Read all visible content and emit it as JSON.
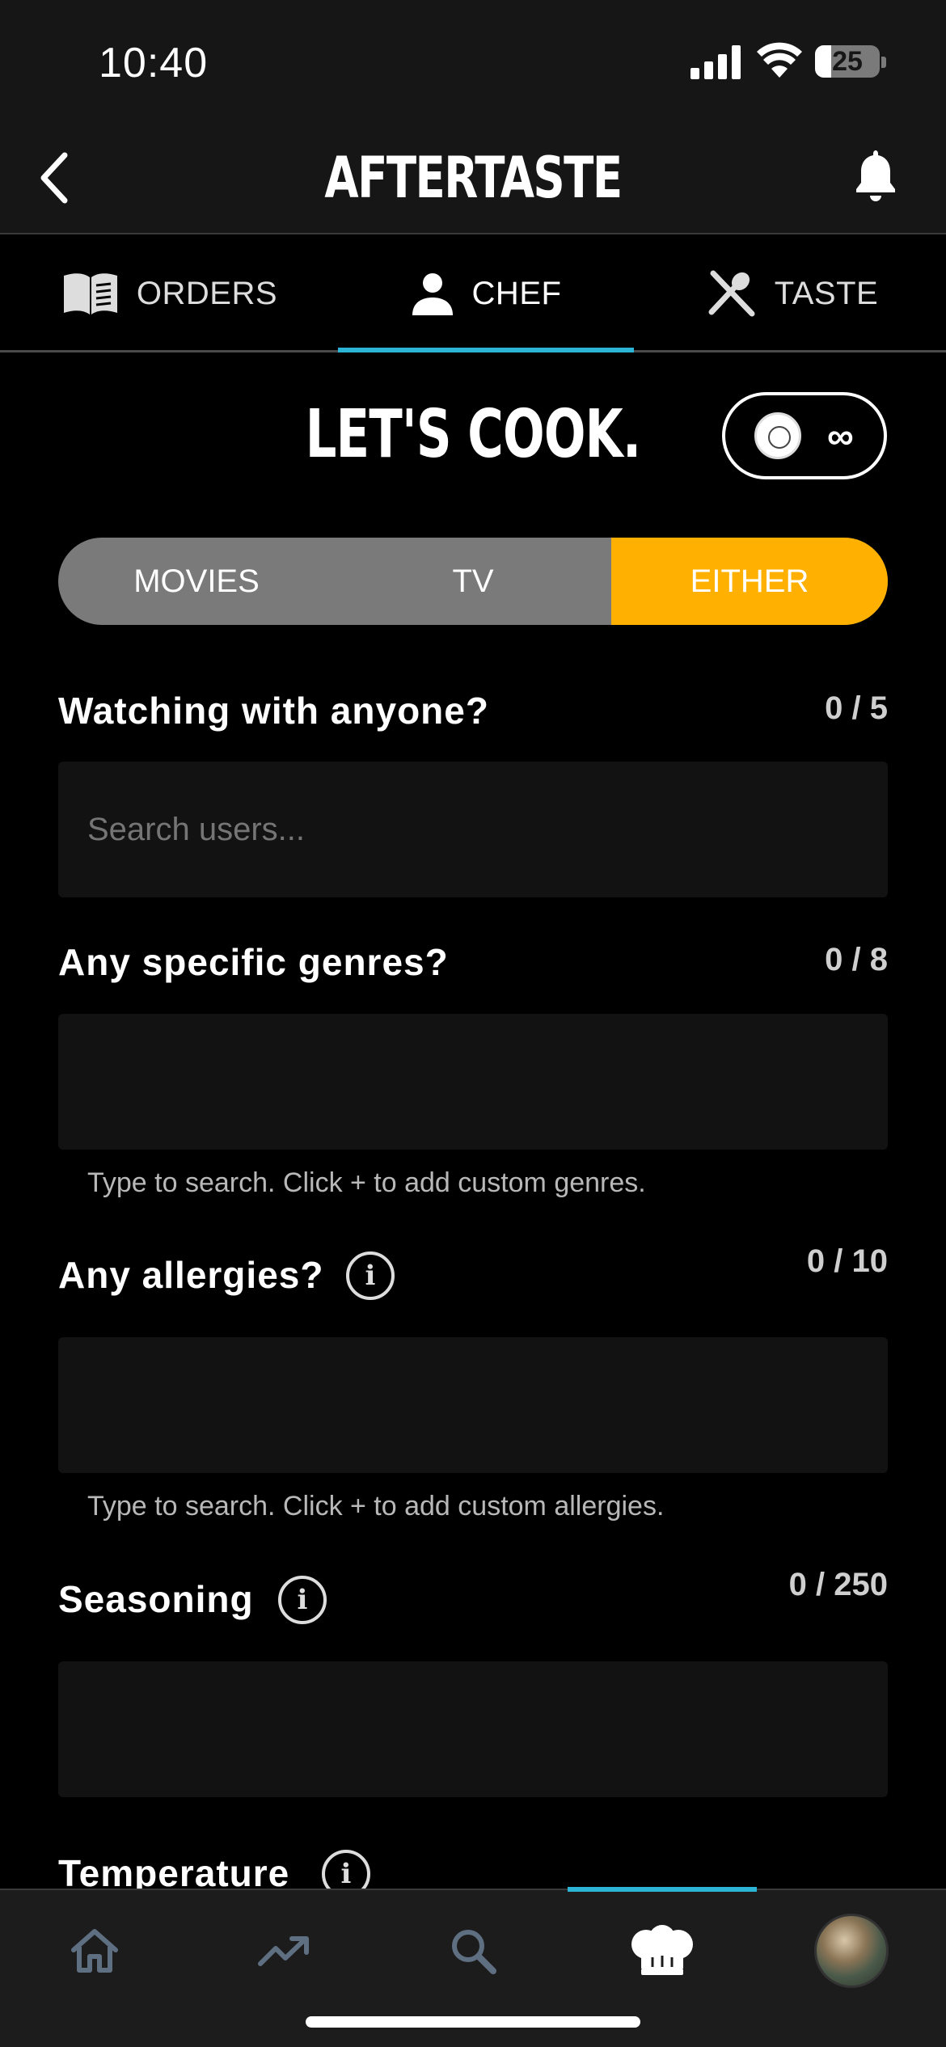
{
  "status": {
    "time": "10:40",
    "battery": "25",
    "battery_level": 0.25
  },
  "header": {
    "title": "AFTERTASTE",
    "back_icon": "chevron-left-icon",
    "bell_icon": "bell-icon"
  },
  "tabs": [
    {
      "label": "ORDERS",
      "icon": "book-icon",
      "active": false
    },
    {
      "label": "CHEF",
      "icon": "person-icon",
      "active": true
    },
    {
      "label": "TASTE",
      "icon": "fork-spoon-icon",
      "active": false
    }
  ],
  "main": {
    "title": "LET'S COOK.",
    "credits": "∞",
    "segment": [
      {
        "label": "MOVIES",
        "active": false
      },
      {
        "label": "TV",
        "active": false
      },
      {
        "label": "EITHER",
        "active": true
      }
    ],
    "watching": {
      "label": "Watching with anyone?",
      "count": "0 / 5",
      "placeholder": "Search users..."
    },
    "genres": {
      "label": "Any specific genres?",
      "count": "0 / 8",
      "hint": "Type to search. Click + to add custom genres."
    },
    "allergies": {
      "label": "Any allergies?",
      "count": "0 / 10",
      "hint": "Type to search. Click + to add custom allergies."
    },
    "seasoning": {
      "label": "Seasoning",
      "count": "0 / 250"
    },
    "temperature": {
      "label": "Temperature"
    }
  },
  "bottom_nav": [
    {
      "icon": "home-icon"
    },
    {
      "icon": "trending-icon"
    },
    {
      "icon": "search-icon"
    },
    {
      "icon": "chef-hat-icon",
      "active": true
    },
    {
      "icon": "avatar"
    }
  ],
  "colors": {
    "accent": "#2bb4d4",
    "active_segment": "#ffb000",
    "segment_bg": "#7a7a7a"
  }
}
